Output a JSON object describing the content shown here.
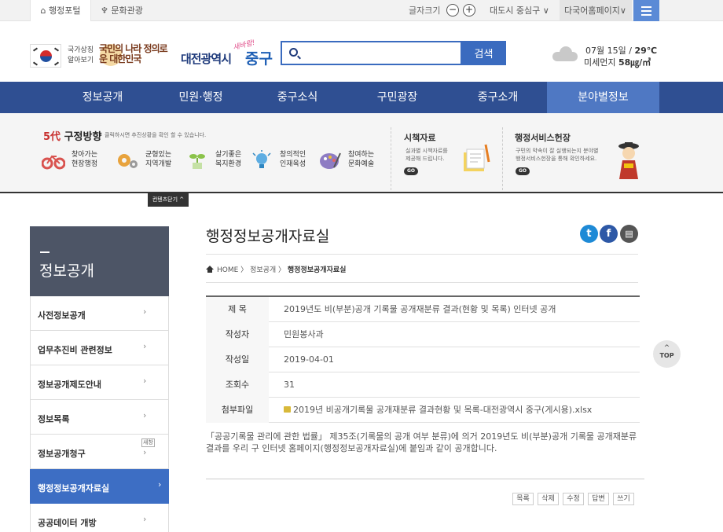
{
  "topbar": {
    "portal_tab": "행정포털",
    "culture_tab": "문화관광",
    "font_size_label": "글자크기",
    "minus": "−",
    "plus": "+",
    "district": "대도시 중심구 ∨",
    "language": "다국어홈페이지∨"
  },
  "header": {
    "national_symbol_text_1": "국가상징",
    "national_symbol_text_2": "알아보기",
    "slogan": "국민의 나라 정의로운 대한민국",
    "city_name": "대전광역시",
    "district_name": "중구",
    "district_script": "새바람!",
    "search_placeholder": "",
    "search_button": "검색",
    "weather_date": "07월 15일 / ",
    "weather_temp": "29℃",
    "weather_dust_label": "미세먼지 ",
    "weather_dust_value": "58㎍/㎥"
  },
  "gnb": {
    "items": [
      "정보공개",
      "민원·행정",
      "중구소식",
      "구민광장",
      "중구소개",
      "분야별정보"
    ],
    "active_index": 5
  },
  "band": {
    "title_red": "5代",
    "title_rest": "구정방향",
    "subtitle": "클릭하시면 추진상황을 확인 할 수 있습니다.",
    "directions": [
      {
        "line1": "찾아가는",
        "line2": "현장행정",
        "icon": "bicycle-icon"
      },
      {
        "line1": "균형있는",
        "line2": "지역개발",
        "icon": "gears-icon"
      },
      {
        "line1": "살기좋은",
        "line2": "복지환경",
        "icon": "plant-icon"
      },
      {
        "line1": "창의적인",
        "line2": "인재육성",
        "icon": "lightbulb-icon"
      },
      {
        "line1": "참여하는",
        "line2": "문화예술",
        "icon": "palette-icon"
      }
    ],
    "policy_title": "시책자료",
    "policy_desc_1": "실과별 시책자료를",
    "policy_desc_2": "제공해 드립니다.",
    "service_title": "행정서비스헌장",
    "service_desc_1": "구민의 약속이 잘 실행되는지 분야별",
    "service_desc_2": "행정서비스헌장을 통해 확인하세요.",
    "go": "GO",
    "collapse": "컨텐츠닫기 ^"
  },
  "lnb": {
    "title": "정보공개",
    "items": [
      {
        "label": "사전정보공개",
        "arrow": "›"
      },
      {
        "label": "업무추진비 관련정보",
        "arrow": "›"
      },
      {
        "label": "정보공개제도안내",
        "arrow": "›"
      },
      {
        "label": "정보목록",
        "arrow": "›"
      },
      {
        "label": "정보공개청구",
        "arrow": "›",
        "badge": "새창"
      },
      {
        "label": "행정정보공개자료실",
        "arrow": "›"
      },
      {
        "label": "공공데이터 개방",
        "arrow": "›"
      }
    ],
    "active_index": 5
  },
  "content": {
    "title": "행정정보공개자료실",
    "breadcrumb_home": "HOME",
    "breadcrumb_sep": " 〉 ",
    "breadcrumb_1": "정보공개",
    "breadcrumb_2": "행정정보공개자료실",
    "sns_twitter": "t",
    "sns_facebook": "f",
    "sns_print": "▤",
    "rows": [
      {
        "label": "제  목",
        "value": "2019년도 비(부분)공개 기록물 공개재분류 결과(현황 및 목록) 인터넷 공개"
      },
      {
        "label": "작성자",
        "value": "민원봉사과"
      },
      {
        "label": "작성일",
        "value": "2019-04-01"
      },
      {
        "label": "조회수",
        "value": "31"
      },
      {
        "label": "첨부파일",
        "value": "2019년 비공개기록물 공개재분류 결과현황 및 목록-대전광역시 중구(게시용).xlsx"
      }
    ],
    "body": "「공공기록물 관리에 관한 법률」 제35조(기록물의 공개 여부 분류)에 의거 2019년도 비(부분)공개 기록물 공개재분류 결과를 우리 구 인터넷 홈페이지(행정정보공개자료실)에 붙임과 같이 공개합니다.",
    "buttons": [
      "목록",
      "삭제",
      "수정",
      "답변",
      "쓰기"
    ]
  },
  "top_button": {
    "arrow": "^",
    "label": "TOP"
  },
  "colors": {
    "nav": "#2f4f92",
    "nav_active": "#4f78c3",
    "accent": "#3a6bbf",
    "sidebar_head": "#4d5566"
  }
}
